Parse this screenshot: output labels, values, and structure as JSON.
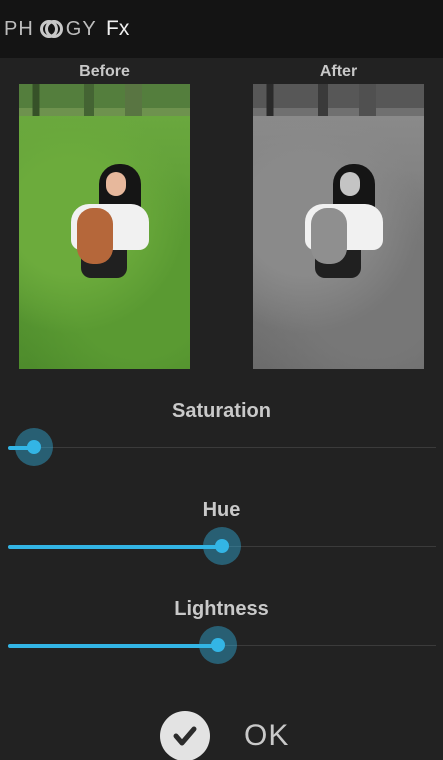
{
  "app": {
    "logo_left": "PH",
    "logo_right": "GY",
    "title": "Fx"
  },
  "preview": {
    "before_label": "Before",
    "after_label": "After"
  },
  "sliders": [
    {
      "label": "Saturation",
      "value": 0.06,
      "color": "#33b5e5"
    },
    {
      "label": "Hue",
      "value": 0.5,
      "color": "#33b5e5"
    },
    {
      "label": "Lightness",
      "value": 0.49,
      "color": "#33b5e5"
    }
  ],
  "actions": {
    "ok_label": "OK",
    "ok_icon": "check-icon"
  },
  "colors": {
    "accent": "#33b5e5",
    "background": "#222222",
    "topbar": "#141414"
  }
}
